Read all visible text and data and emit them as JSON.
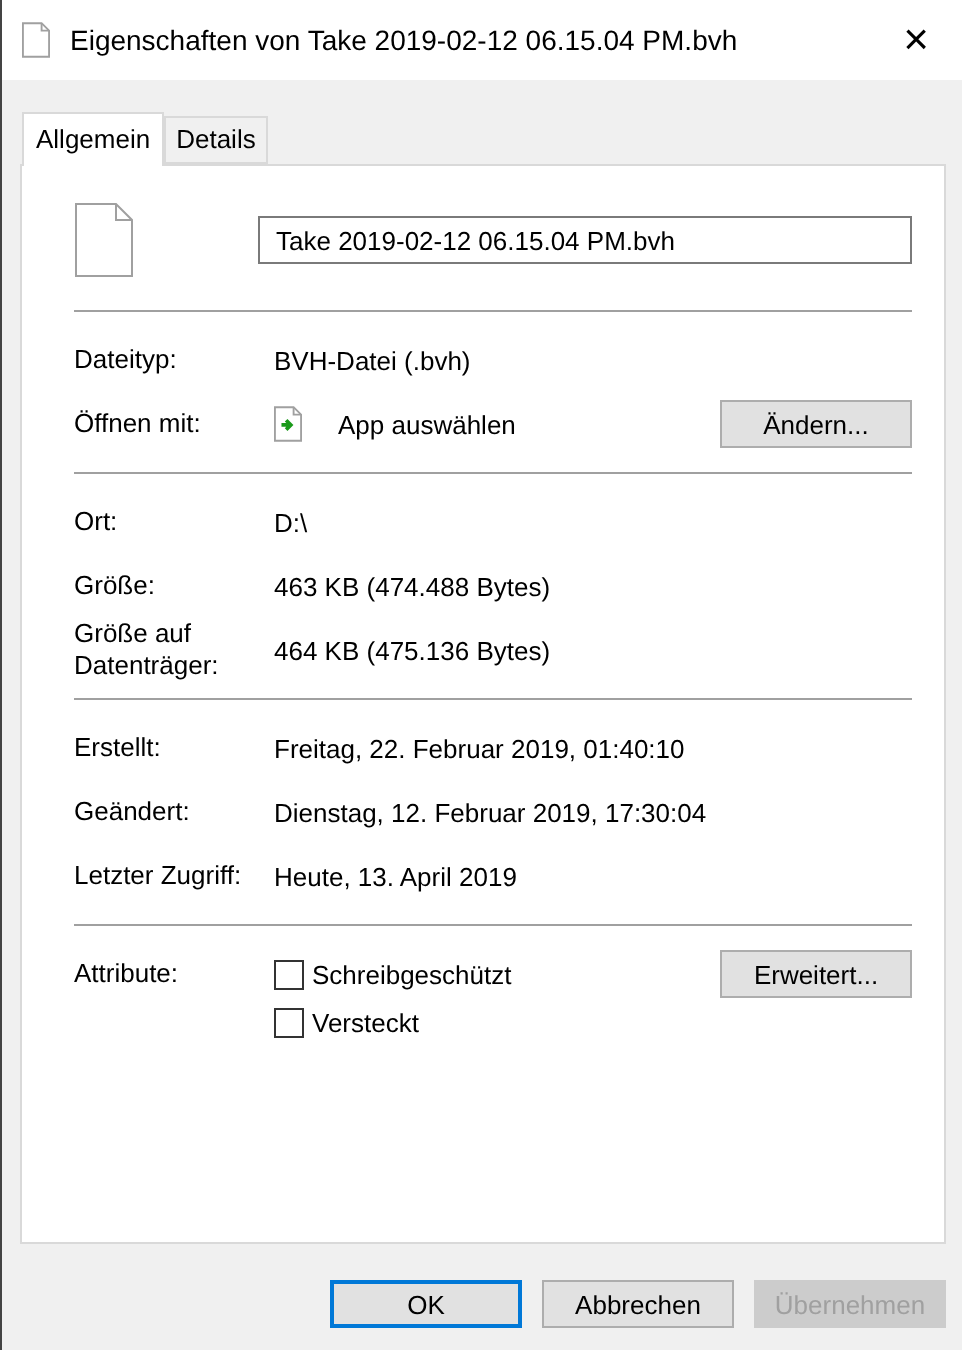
{
  "window": {
    "title": "Eigenschaften von Take 2019-02-12 06.15.04 PM.bvh",
    "close": "×"
  },
  "tabs": [
    {
      "label": "Allgemein",
      "selected": true
    },
    {
      "label": "Details",
      "selected": false
    }
  ],
  "file_name": {
    "value": "Take 2019-02-12 06.15.04 PM.bvh"
  },
  "sections": [
    {
      "rows": [
        {
          "kind": "text",
          "label": "Dateityp:",
          "value": "BVH-Datei (.bvh)"
        },
        {
          "kind": "app",
          "label": "Öffnen mit:",
          "value": "App auswählen",
          "button": "Ändern..."
        }
      ]
    },
    {
      "rows": [
        {
          "kind": "text",
          "label": "Ort:",
          "value": "D:\\"
        },
        {
          "kind": "text",
          "label": "Größe:",
          "value": "463 KB (474.488 Bytes)"
        },
        {
          "kind": "text",
          "label": "Größe auf Datenträger:",
          "value": "464 KB (475.136 Bytes)"
        }
      ]
    },
    {
      "rows": [
        {
          "kind": "text",
          "label": "Erstellt:",
          "value": "Freitag, 22. Februar 2019, 01:40:10"
        },
        {
          "kind": "text",
          "label": "Geändert:",
          "value": "Dienstag, 12. Februar 2019, 17:30:04"
        },
        {
          "kind": "text",
          "label": "Letzter Zugriff:",
          "value": "Heute, 13. April 2019"
        }
      ]
    }
  ],
  "attributes": {
    "label": "Attribute:",
    "button": "Erweitert...",
    "checkboxes": [
      {
        "label": "Schreibgeschützt",
        "checked": false
      },
      {
        "label": "Versteckt",
        "checked": false
      }
    ]
  },
  "buttons": [
    {
      "label": "OK",
      "disabled": false,
      "default": true
    },
    {
      "label": "Abbrechen",
      "disabled": false,
      "default": false
    },
    {
      "label": "Übernehmen",
      "disabled": true,
      "default": false
    }
  ]
}
